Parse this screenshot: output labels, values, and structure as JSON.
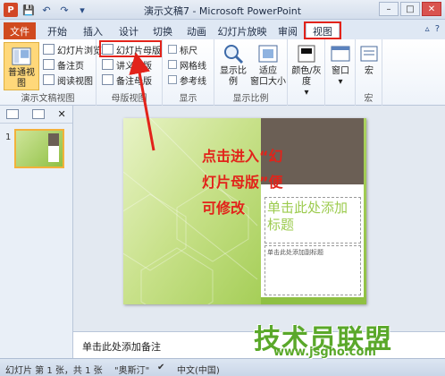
{
  "window": {
    "title": "演示文稿7 - Microsoft PowerPoint",
    "controls": {
      "minimize": "–",
      "maximize": "□",
      "close": "✕"
    }
  },
  "qat": {
    "app_icon": "P",
    "save": "💾",
    "undo": "↶",
    "redo": "↷",
    "customize": "▾"
  },
  "tabs": {
    "file": "文件",
    "home": "开始",
    "insert": "插入",
    "design": "设计",
    "transitions": "切换",
    "animations": "动画",
    "slideshow": "幻灯片放映",
    "review": "审阅",
    "view": "视图"
  },
  "tabrow_right": {
    "minimize_ribbon": "▵",
    "help": "?"
  },
  "ribbon": {
    "presentation_views": {
      "label": "演示文稿视图",
      "normal": "普通视图",
      "slide_sorter": "幻灯片浏览",
      "notes_page": "备注页",
      "reading_view": "阅读视图"
    },
    "master_views": {
      "label": "母版视图",
      "slide_master": "幻灯片母版",
      "handout_master": "讲义母版",
      "notes_master": "备注母版"
    },
    "show": {
      "label": "显示",
      "ruler": "标尺",
      "gridlines": "网格线",
      "guides": "参考线"
    },
    "zoom": {
      "label": "显示比例",
      "zoom": "显示比例",
      "fit_window_1": "适应",
      "fit_window_2": "窗口大小"
    },
    "color": {
      "label": "颜色/灰度"
    },
    "window": {
      "label": "窗口"
    },
    "macros": {
      "label": "宏",
      "group_label": "宏"
    }
  },
  "slides_panel": {
    "slide_number": "1"
  },
  "slide": {
    "title_placeholder": "单击此处添加标题",
    "subtitle_placeholder": "单击此处添加副标题"
  },
  "annotation": {
    "line1": "点击进入“幻",
    "line2": "灯片母版”便",
    "line3": "可修改"
  },
  "notes": {
    "placeholder": "单击此处添加备注"
  },
  "statusbar": {
    "slide_info": "幻灯片 第 1 张，共 1 张",
    "theme": "\"奥斯汀\"",
    "language": "中文(中国)"
  },
  "watermark": {
    "main": "技术员联盟",
    "url": "www.jsgho.com"
  }
}
